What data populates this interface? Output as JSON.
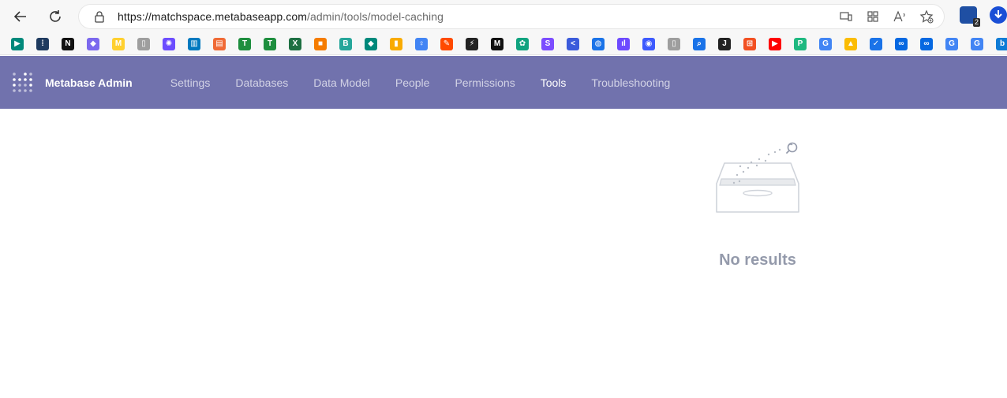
{
  "browser": {
    "url_host": "https://matchspace.metabaseapp.com",
    "url_path": "/admin/tools/model-caching",
    "extension_badge": "2"
  },
  "bookmarks": [
    {
      "name": "meet-icon",
      "color": "#00897b",
      "glyph": "▶"
    },
    {
      "name": "apps-grid-icon",
      "color": "#1e3a5f",
      "glyph": "⁞"
    },
    {
      "name": "notion-icon",
      "color": "#111111",
      "glyph": "N"
    },
    {
      "name": "clickup-icon",
      "color": "#7b68ee",
      "glyph": "◆"
    },
    {
      "name": "miro-icon",
      "color": "#ffd02f",
      "glyph": "M"
    },
    {
      "name": "doc-icon",
      "color": "#9e9e9e",
      "glyph": "▯"
    },
    {
      "name": "spark-icon",
      "color": "#6c4dff",
      "glyph": "✺"
    },
    {
      "name": "trello-icon",
      "color": "#0079bf",
      "glyph": "▥"
    },
    {
      "name": "reader-icon",
      "color": "#f06a35",
      "glyph": "▤"
    },
    {
      "name": "sheets-icon",
      "color": "#1e8e3e",
      "glyph": "T"
    },
    {
      "name": "sheets-alt-icon",
      "color": "#1e8e3e",
      "glyph": "T"
    },
    {
      "name": "excel-icon",
      "color": "#1d6f42",
      "glyph": "X"
    },
    {
      "name": "cube-icon",
      "color": "#f57c00",
      "glyph": "■"
    },
    {
      "name": "bubble-icon",
      "color": "#26a69a",
      "glyph": "B"
    },
    {
      "name": "diamond-icon",
      "color": "#00897b",
      "glyph": "◆"
    },
    {
      "name": "analytics-icon",
      "color": "#f9ab00",
      "glyph": "▮"
    },
    {
      "name": "person-icon",
      "color": "#4285f4",
      "glyph": "♀"
    },
    {
      "name": "zapier-icon",
      "color": "#ff4a00",
      "glyph": "✎"
    },
    {
      "name": "bolt-icon",
      "color": "#222222",
      "glyph": "⚡"
    },
    {
      "name": "medium-icon",
      "color": "#111111",
      "glyph": "M"
    },
    {
      "name": "openai-icon",
      "color": "#10a37f",
      "glyph": "✿"
    },
    {
      "name": "s-app-icon",
      "color": "#7c4dff",
      "glyph": "S"
    },
    {
      "name": "linear-icon",
      "color": "#3b5bdb",
      "glyph": "<"
    },
    {
      "name": "chat-icon",
      "color": "#1a73e8",
      "glyph": "◍"
    },
    {
      "name": "audio-icon",
      "color": "#6d4aff",
      "glyph": "ıl"
    },
    {
      "name": "messenger-icon",
      "color": "#3d5afe",
      "glyph": "◉"
    },
    {
      "name": "page-icon",
      "color": "#9e9e9e",
      "glyph": "▯"
    },
    {
      "name": "search-icon",
      "color": "#1a73e8",
      "glyph": "⌕"
    },
    {
      "name": "j-icon",
      "color": "#222222",
      "glyph": "J"
    },
    {
      "name": "microsoft-icon",
      "color": "#f25022",
      "glyph": "⊞"
    },
    {
      "name": "youtube-icon",
      "color": "#ff0000",
      "glyph": "▶"
    },
    {
      "name": "p-icon",
      "color": "#1eb980",
      "glyph": "P"
    },
    {
      "name": "google-icon",
      "color": "#4285f4",
      "glyph": "G"
    },
    {
      "name": "ads-icon",
      "color": "#fbbc04",
      "glyph": "▲"
    },
    {
      "name": "shield-icon",
      "color": "#1a73e8",
      "glyph": "✓"
    },
    {
      "name": "meta-icon",
      "color": "#0668e1",
      "glyph": "∞"
    },
    {
      "name": "meta-alt-icon",
      "color": "#0668e1",
      "glyph": "∞"
    },
    {
      "name": "google-alt-icon",
      "color": "#4285f4",
      "glyph": "G"
    },
    {
      "name": "google-third-icon",
      "color": "#4285f4",
      "glyph": "G"
    },
    {
      "name": "bing-icon",
      "color": "#0f7cd6",
      "glyph": "b"
    }
  ],
  "admin": {
    "brand": "Metabase Admin",
    "nav": [
      {
        "label": "Settings",
        "active": false
      },
      {
        "label": "Databases",
        "active": false
      },
      {
        "label": "Data Model",
        "active": false
      },
      {
        "label": "People",
        "active": false
      },
      {
        "label": "Permissions",
        "active": false
      },
      {
        "label": "Tools",
        "active": true
      },
      {
        "label": "Troubleshooting",
        "active": false
      }
    ]
  },
  "empty_state": {
    "message": "No results"
  },
  "colors": {
    "nav_bg": "#7172ad",
    "empty_text": "#949aab"
  }
}
